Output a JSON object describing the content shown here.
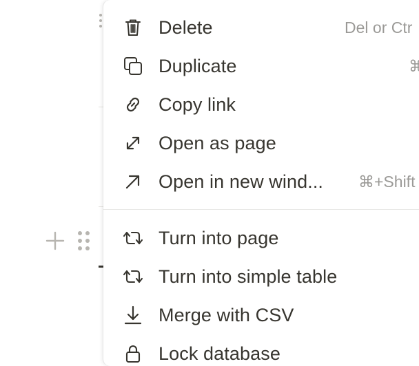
{
  "menu": {
    "items": [
      {
        "label": "Delete",
        "shortcut": "Del or Ctr",
        "icon": "trash-icon"
      },
      {
        "label": "Duplicate",
        "shortcut": "⌘",
        "icon": "duplicate-icon"
      },
      {
        "label": "Copy link",
        "shortcut": "",
        "icon": "link-icon"
      },
      {
        "label": "Open as page",
        "shortcut": "",
        "icon": "expand-arrows-icon"
      },
      {
        "label": "Open in new wind...",
        "shortcut": "⌘+Shift",
        "icon": "arrow-up-right-icon"
      },
      {
        "label": "Turn into page",
        "shortcut": "",
        "icon": "turn-into-icon"
      },
      {
        "label": "Turn into simple table",
        "shortcut": "",
        "icon": "turn-into-icon"
      },
      {
        "label": "Merge with CSV",
        "shortcut": "",
        "icon": "arrow-down-icon"
      },
      {
        "label": "Lock database",
        "shortcut": "",
        "icon": "lock-icon"
      }
    ]
  },
  "colors": {
    "text": "#37352f",
    "muted": "#9b9a97",
    "handle": "#b7b5b0",
    "divider": "#e9e9e7"
  }
}
